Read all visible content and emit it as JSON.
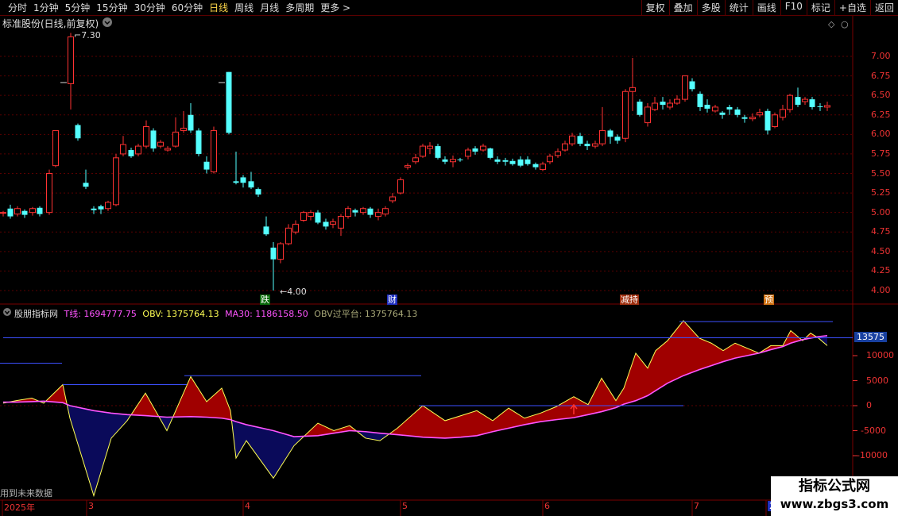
{
  "toolbar": {
    "periods": [
      "分时",
      "1分钟",
      "5分钟",
      "15分钟",
      "30分钟",
      "60分钟",
      "日线",
      "周线",
      "月线",
      "多周期",
      "更多 >"
    ],
    "active_period": "日线",
    "right_buttons": [
      "复权",
      "叠加",
      "多股",
      "统计",
      "画线",
      "F10",
      "标记",
      "+自选",
      "返回"
    ]
  },
  "chart_title": "标准股份(日线,前复权)",
  "price_axis": [
    "7.00",
    "6.75",
    "6.50",
    "6.25",
    "6.00",
    "5.75",
    "5.50",
    "5.25",
    "5.00",
    "4.75",
    "4.50",
    "4.25",
    "4.00"
  ],
  "high_marker": "7.30",
  "low_marker": "4.00",
  "badges": [
    "跌",
    "财",
    "减持",
    "预"
  ],
  "indicator": {
    "name": "股朋指标网",
    "t_label": "T线: 1694777.75",
    "obv_label": "OBV: 1375764.13",
    "ma_label": "MA30: 1186158.50",
    "cross_label": "OBV过平台: 1375764.13"
  },
  "ind_axis": [
    "13575",
    "10000",
    "5000",
    "0",
    "-5000",
    "-10000"
  ],
  "date_labels": [
    "2025年",
    "3",
    "4",
    "5",
    "6",
    "7",
    "2"
  ],
  "watermark_text": "用到未来数据",
  "logo": {
    "line1": "指标公式网",
    "line2": "www.zbgs3.com"
  },
  "colors": {
    "up": "#ff3232",
    "down": "#54ffff",
    "obv": "#ffff54",
    "ma": "#ff54ff",
    "fill_up": "#a00000",
    "fill_down": "#0a0a5a",
    "platform": "#3c50ff"
  }
}
